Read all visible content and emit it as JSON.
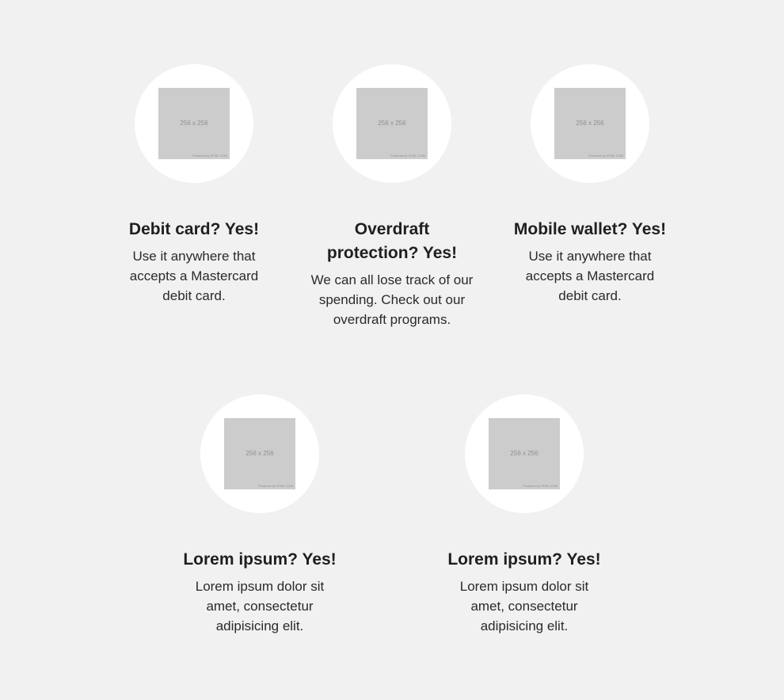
{
  "features": [
    {
      "image": {
        "dimensions": "256 x 256",
        "powered_by": "Powered by HTML.COM"
      },
      "title": "Debit card? Yes!",
      "description": "Use it anywhere that accepts a Mastercard debit card."
    },
    {
      "image": {
        "dimensions": "256 x 256",
        "powered_by": "Powered by HTML.COM"
      },
      "title": "Overdraft protection? Yes!",
      "description": "We can all lose track of our spending. Check out our overdraft programs."
    },
    {
      "image": {
        "dimensions": "256 x 256",
        "powered_by": "Powered by HTML.COM"
      },
      "title": "Mobile wallet? Yes!",
      "description": "Use it anywhere that accepts a Mastercard debit card."
    },
    {
      "image": {
        "dimensions": "256 x 256",
        "powered_by": "Powered by HTML.COM"
      },
      "title": "Lorem ipsum? Yes!",
      "description": "Lorem ipsum dolor sit amet, consectetur adipisicing elit."
    },
    {
      "image": {
        "dimensions": "256 x 256",
        "powered_by": "Powered by HTML.COM"
      },
      "title": "Lorem ipsum? Yes!",
      "description": "Lorem ipsum dolor sit amet, consectetur adipisicing elit."
    }
  ],
  "colors": {
    "background": "#f1f1f1",
    "circle": "#ffffff",
    "placeholder": "#cccccc",
    "text": "#1f1f1f"
  }
}
